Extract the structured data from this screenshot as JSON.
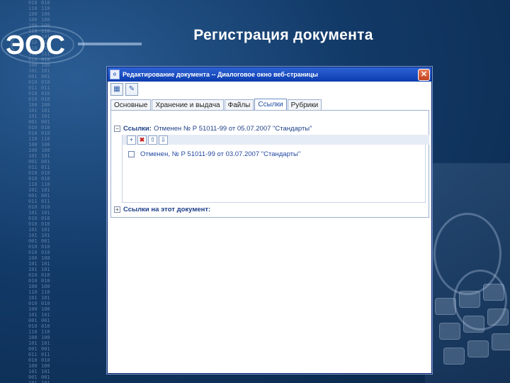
{
  "slide": {
    "title": "Регистрация документа"
  },
  "logo": {
    "text": "ЭОС"
  },
  "binary_strip": "01011010010010011010101001011101010010100101001101001010010110100101001011010010010100101101001011010100101101010101001010110100101001010010110101001010011010101010010100101011010010100101101010010100110101010100101001010110100101001011010100101001101010101001010010101101001010010110101001010011010101",
  "window": {
    "title": "Редактирование документа -- Диалоговое окно веб-страницы",
    "close_label": "✕"
  },
  "toolbar": {
    "icons": [
      "save-icon",
      "properties-icon"
    ]
  },
  "tabs": [
    {
      "label": "Основные",
      "active": false
    },
    {
      "label": "Хранение и выдача",
      "active": false
    },
    {
      "label": "Файлы",
      "active": false
    },
    {
      "label": "Ссылки",
      "active": true
    },
    {
      "label": "Рубрики",
      "active": false
    }
  ],
  "refs_section": {
    "label": "Ссылки:",
    "value": "Отменен № Р 51011-99 от 05.07.2007 \"Стандарты\"",
    "expander": "−"
  },
  "refs_toolbar": {
    "buttons": [
      {
        "icon": "add-link-icon",
        "glyph": "+"
      },
      {
        "icon": "delete-icon",
        "glyph": "✖"
      },
      {
        "icon": "arrow-up-icon",
        "glyph": "⇧"
      },
      {
        "icon": "arrow-down-icon",
        "glyph": "⇩"
      }
    ]
  },
  "refs_items": [
    {
      "text": "Отменен, № Р 51011-99 от 03.07.2007 \"Стандарты\""
    }
  ],
  "back_refs_section": {
    "label": "Ссылки на этот документ:",
    "expander": "+"
  },
  "colors": {
    "titlebar": "#0b3cae",
    "link_text": "#2347a0",
    "background": "#123a68"
  }
}
